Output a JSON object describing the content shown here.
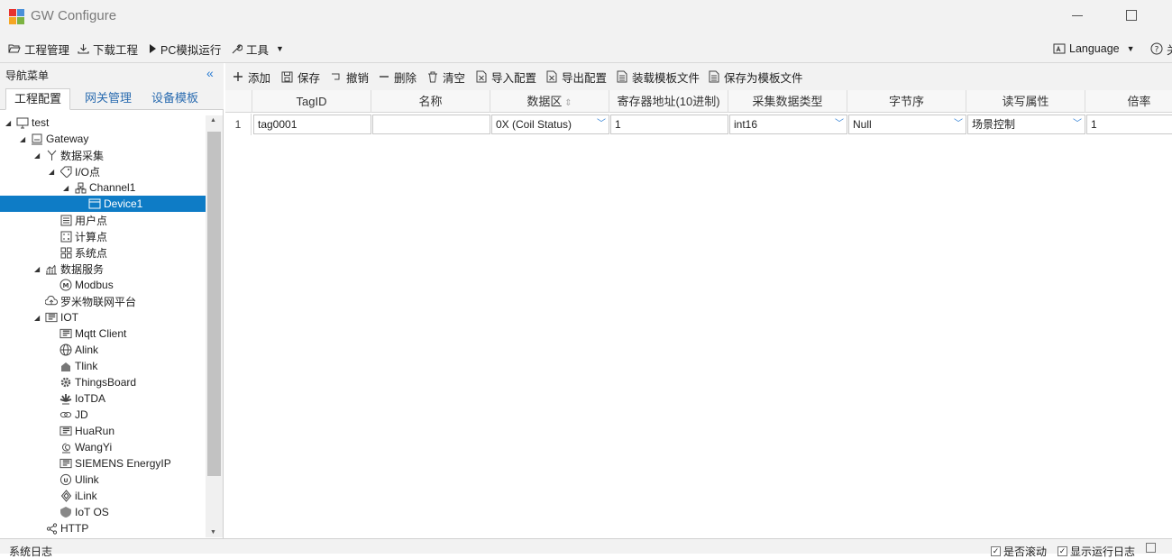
{
  "app": {
    "title": "GW Configure"
  },
  "menu": {
    "items": [
      {
        "label": "工程管理",
        "icon": "folder-open-icon"
      },
      {
        "label": "下载工程",
        "icon": "download-icon"
      },
      {
        "label": "PC模拟运行",
        "icon": "play-icon"
      },
      {
        "label": "工具",
        "icon": "wrench-icon"
      }
    ],
    "language": "Language",
    "help": "关"
  },
  "nav": {
    "title": "导航菜单",
    "tabs": [
      "工程配置",
      "网关管理",
      "设备模板"
    ],
    "tree": [
      {
        "label": "test",
        "depth": 0,
        "arrow": true,
        "icon": "monitor-icon"
      },
      {
        "label": "Gateway",
        "depth": 1,
        "arrow": true,
        "icon": "gateway-icon"
      },
      {
        "label": "数据采集",
        "depth": 2,
        "arrow": true,
        "icon": "branch-icon"
      },
      {
        "label": "I/O点",
        "depth": 3,
        "arrow": true,
        "icon": "tag-icon"
      },
      {
        "label": "Channel1",
        "depth": 4,
        "arrow": true,
        "icon": "network-icon"
      },
      {
        "label": "Device1",
        "depth": 5,
        "arrow": false,
        "icon": "device-icon",
        "selected": true
      },
      {
        "label": "用户点",
        "depth": 3,
        "arrow": false,
        "icon": "list-icon"
      },
      {
        "label": "计算点",
        "depth": 3,
        "arrow": false,
        "icon": "calculator-icon"
      },
      {
        "label": "系统点",
        "depth": 3,
        "arrow": false,
        "icon": "grid-icon"
      },
      {
        "label": "数据服务",
        "depth": 2,
        "arrow": true,
        "icon": "chart-icon"
      },
      {
        "label": "Modbus",
        "depth": 3,
        "arrow": false,
        "icon": "modbus-icon"
      },
      {
        "label": "罗米物联网平台",
        "depth": 2,
        "arrow": false,
        "icon": "cloud-icon"
      },
      {
        "label": "IOT",
        "depth": 2,
        "arrow": true,
        "icon": "iot-icon"
      },
      {
        "label": "Mqtt Client",
        "depth": 3,
        "arrow": false,
        "icon": "iot-icon"
      },
      {
        "label": "Alink",
        "depth": 3,
        "arrow": false,
        "icon": "globe-icon"
      },
      {
        "label": "Tlink",
        "depth": 3,
        "arrow": false,
        "icon": "home-icon"
      },
      {
        "label": "ThingsBoard",
        "depth": 3,
        "arrow": false,
        "icon": "gear-icon"
      },
      {
        "label": "IoTDA",
        "depth": 3,
        "arrow": false,
        "icon": "flower-icon"
      },
      {
        "label": "JD",
        "depth": 3,
        "arrow": false,
        "icon": "link-icon"
      },
      {
        "label": "HuaRun",
        "depth": 3,
        "arrow": false,
        "icon": "iot-icon"
      },
      {
        "label": "WangYi",
        "depth": 3,
        "arrow": false,
        "icon": "swirl-icon"
      },
      {
        "label": "SIEMENS EnergyIP",
        "depth": 3,
        "arrow": false,
        "icon": "iot-icon"
      },
      {
        "label": "Ulink",
        "depth": 3,
        "arrow": false,
        "icon": "ulink-icon"
      },
      {
        "label": "iLink",
        "depth": 3,
        "arrow": false,
        "icon": "diamond-icon"
      },
      {
        "label": "IoT OS",
        "depth": 3,
        "arrow": false,
        "icon": "shield-icon"
      },
      {
        "label": "HTTP",
        "depth": 2,
        "arrow": false,
        "icon": "share-icon"
      }
    ]
  },
  "toolbar": {
    "buttons": [
      {
        "label": "添加",
        "icon": "plus-icon"
      },
      {
        "label": "保存",
        "icon": "save-icon"
      },
      {
        "label": "撤销",
        "icon": "undo-icon"
      },
      {
        "label": "删除",
        "icon": "minus-icon"
      },
      {
        "label": "清空",
        "icon": "trash-icon"
      },
      {
        "label": "导入配置",
        "icon": "import-icon"
      },
      {
        "label": "导出配置",
        "icon": "export-icon"
      },
      {
        "label": "装载模板文件",
        "icon": "load-file-icon"
      },
      {
        "label": "保存为模板文件",
        "icon": "save-file-icon"
      }
    ]
  },
  "grid": {
    "columns": [
      "TagID",
      "名称",
      "数据区",
      "寄存器地址(10进制)",
      "采集数据类型",
      "字节序",
      "读写属性",
      "倍率"
    ],
    "rows": [
      {
        "num": "1",
        "cells": [
          "tag0001",
          "",
          "0X (Coil Status)",
          "1",
          "int16",
          "Null",
          "场景控制",
          "1"
        ]
      }
    ]
  },
  "status": {
    "title": "系统日志",
    "auto_scroll": "是否滚动",
    "show_log": "显示运行日志"
  }
}
